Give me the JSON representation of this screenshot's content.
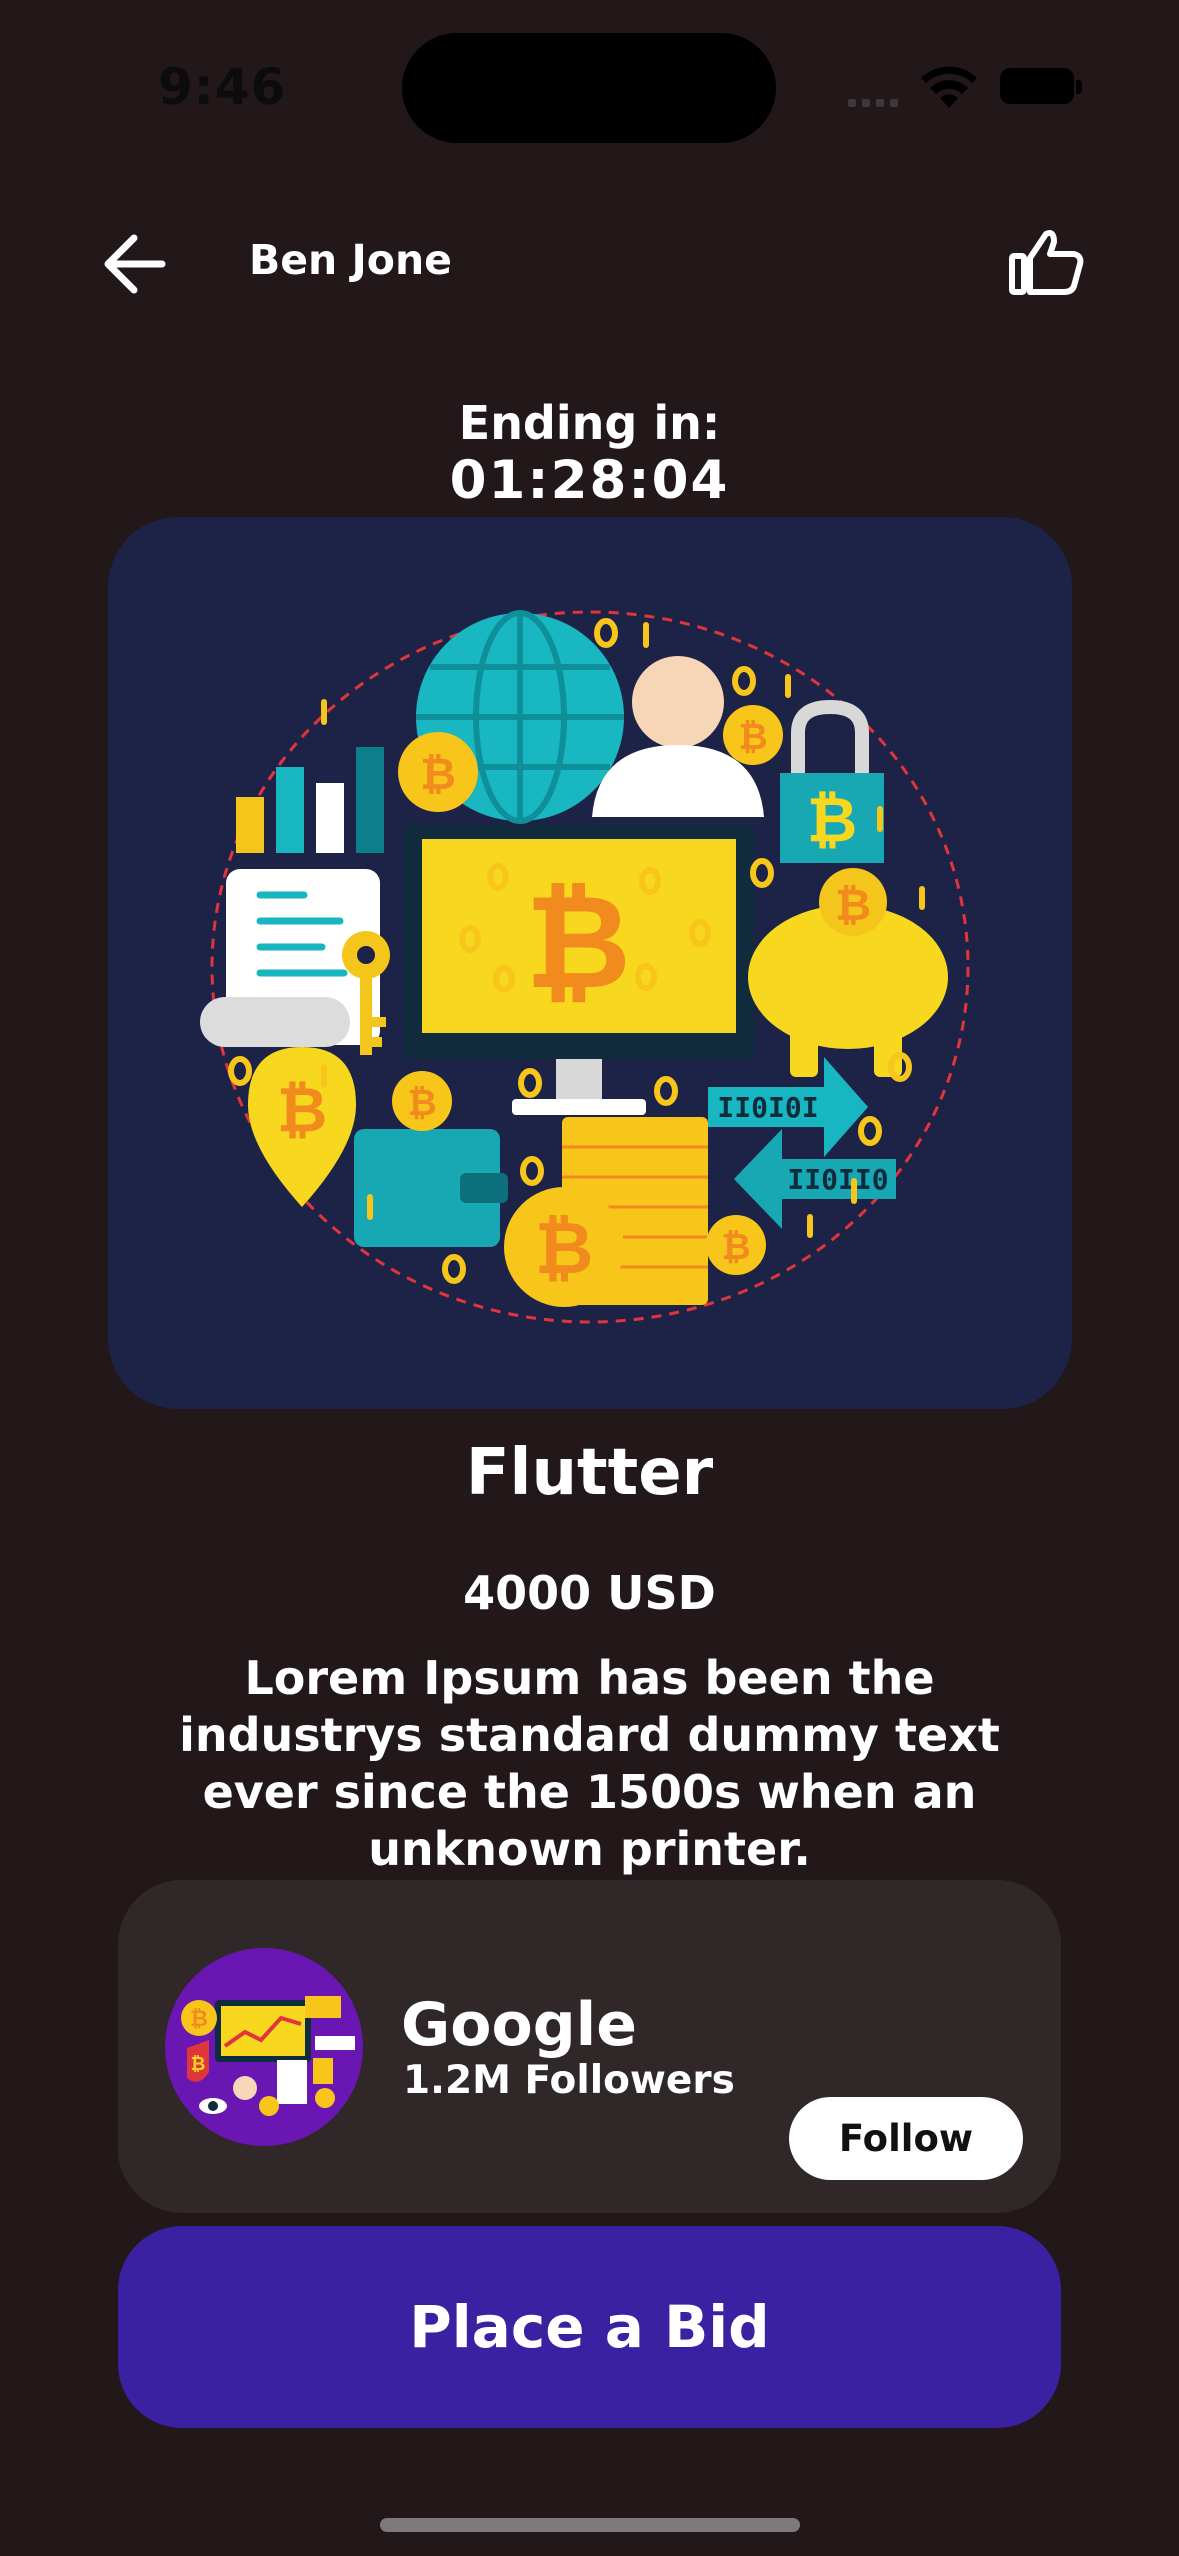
{
  "status_bar": {
    "time": "9:46"
  },
  "header": {
    "author": "Ben Jone"
  },
  "countdown": {
    "label": "Ending in:",
    "time": "01:28:04"
  },
  "artwork": {
    "icon": "bitcoin-collage-illustration"
  },
  "item": {
    "title": "Flutter",
    "price": "4000 USD",
    "description": "Lorem Ipsum has been the industrys standard dummy text ever since the 1500s when an unknown printer."
  },
  "creator": {
    "name": "Google",
    "followers": "1.2M Followers",
    "follow_label": "Follow"
  },
  "actions": {
    "bid_label": "Place a Bid"
  },
  "colors": {
    "background": "#221719",
    "card": "#2f2728",
    "art_bg": "#1d2347",
    "accent": "#3a21a2",
    "avatar_bg": "#6a16b3"
  }
}
